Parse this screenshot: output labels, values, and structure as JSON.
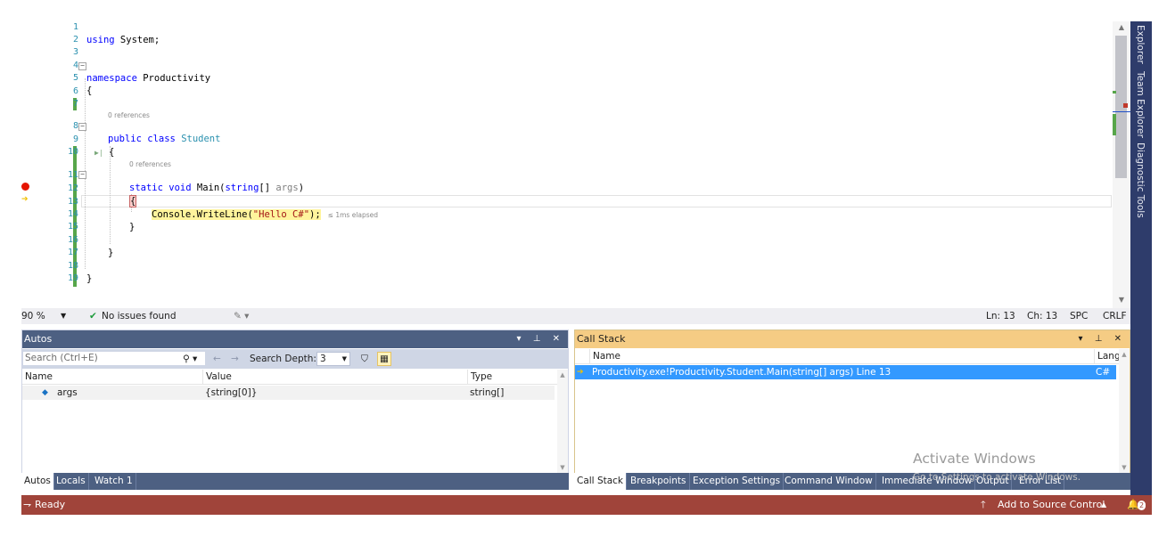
{
  "editor": {
    "lines": [
      {
        "n": "1"
      },
      {
        "n": "2"
      },
      {
        "n": "3"
      },
      {
        "n": "4"
      },
      {
        "n": "5"
      },
      {
        "n": "6"
      },
      {
        "n": "7"
      },
      {
        "n": "8"
      },
      {
        "n": "9"
      },
      {
        "n": "10"
      },
      {
        "n": "11"
      },
      {
        "n": "12"
      },
      {
        "n": "13"
      },
      {
        "n": "14"
      },
      {
        "n": "15"
      },
      {
        "n": "16"
      },
      {
        "n": "17"
      },
      {
        "n": "18"
      },
      {
        "n": "19"
      }
    ],
    "code": {
      "using": "using",
      "system": " System;",
      "namespace_kw": "namespace",
      "namespace_name": " Productivity",
      "brace_open": "{",
      "brace_close": "}",
      "public": "public",
      "class": " class ",
      "student": "Student",
      "static": "static",
      "void": " void ",
      "main": "Main(",
      "string": "string",
      "arr": "[] ",
      "args": "args",
      "paren": ")",
      "console": "Console.WriteLine(",
      "hello": "\"Hello C#\"",
      "end": ");",
      "elapsed": "≤ 1ms elapsed"
    },
    "codelens_student": "0 references",
    "codelens_main": "0 references"
  },
  "editor_status": {
    "zoom": "90 %",
    "issues": "No issues found",
    "line": "Ln: 13",
    "col": "Ch: 13",
    "spc": "SPC",
    "eol": "CRLF"
  },
  "vtabs": [
    "Explorer",
    "Team Explorer",
    "Diagnostic Tools"
  ],
  "autos": {
    "title": "Autos",
    "search_placeholder": "Search (Ctrl+E)",
    "search_depth_label": "Search Depth:",
    "search_depth_value": "3",
    "columns": [
      "Name",
      "Value",
      "Type"
    ],
    "rows": [
      {
        "name": "args",
        "value": "{string[0]}",
        "type": "string[]"
      }
    ],
    "tabs": [
      "Autos",
      "Locals",
      "Watch 1"
    ]
  },
  "callstack": {
    "title": "Call Stack",
    "columns": [
      "Name",
      "Lang"
    ],
    "rows": [
      {
        "name": "Productivity.exe!Productivity.Student.Main(string[] args) Line 13",
        "lang": "C#"
      }
    ],
    "tabs": [
      "Call Stack",
      "Breakpoints",
      "Exception Settings",
      "Command Window",
      "Immediate Window",
      "Output",
      "Error List"
    ]
  },
  "watermark": {
    "line1": "Activate Windows",
    "line2": "Go to Settings to activate Windows."
  },
  "statusbar": {
    "ready": "Ready",
    "source_control": "Add to Source Control",
    "notifications": "2"
  },
  "colors": {
    "accent": "#4d6082",
    "callstack_title": "#f5cc84",
    "statusbar": "#a0443a",
    "selected_row": "#3399ff"
  }
}
